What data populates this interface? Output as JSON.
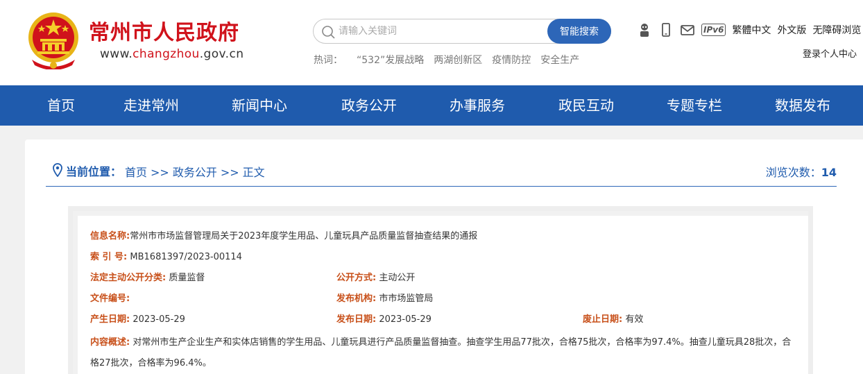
{
  "header": {
    "site_name": "常州市人民政府",
    "url_prefix": "www.",
    "url_highlight": "changzhou",
    "url_suffix": ".gov.cn",
    "search": {
      "placeholder": "请输入关键词",
      "button": "智能搜索"
    },
    "hotwords_label": "热词：",
    "hotwords": [
      "“532”发展战略",
      "两湖创新区",
      "疫情防控",
      "安全生产"
    ],
    "tools": {
      "ipv6": "IPv6",
      "traditional": "繁體中文",
      "foreign": "外文版",
      "accessible": "无障碍浏览"
    },
    "login": "登录个人中心"
  },
  "nav": [
    "首页",
    "走进常州",
    "新闻中心",
    "政务公开",
    "办事服务",
    "政民互动",
    "专题专栏",
    "数据发布"
  ],
  "breadcrumb": {
    "title": "当前位置：",
    "items": [
      "首页",
      "政务公开",
      "正文"
    ],
    "separator": ">>",
    "views_label": "浏览次数：",
    "views": "14"
  },
  "info": {
    "name_label": "信息名称:",
    "name": "常州市市场监督管理局关于2023年度学生用品、儿童玩具产品质量监督抽查结果的通报",
    "index_label": "索 引 号:",
    "index": "MB1681397/2023-00114",
    "category_label": "法定主动公开分类:",
    "category": "质量监督",
    "mode_label": "公开方式:",
    "mode": "主动公开",
    "doc_no_label": "文件编号:",
    "doc_no": "",
    "publisher_label": "发布机构:",
    "publisher": "市市场监管局",
    "created_label": "产生日期:",
    "created": "2023-05-29",
    "published_label": "发布日期:",
    "published": "2023-05-29",
    "expiry_label": "废止日期:",
    "expiry": "有效",
    "summary_label": "内容概述:",
    "summary": "对常州市生产企业生产和实体店销售的学生用品、儿童玩具进行产品质量监督抽查。抽查学生用品77批次，合格75批次，合格率为97.4%。抽查儿童玩具28批次，合格27批次，合格率为96.4%。"
  },
  "colors": {
    "brand_red": "#d0121b",
    "nav_blue": "#1f5bad",
    "label_orange": "#c8501a"
  }
}
